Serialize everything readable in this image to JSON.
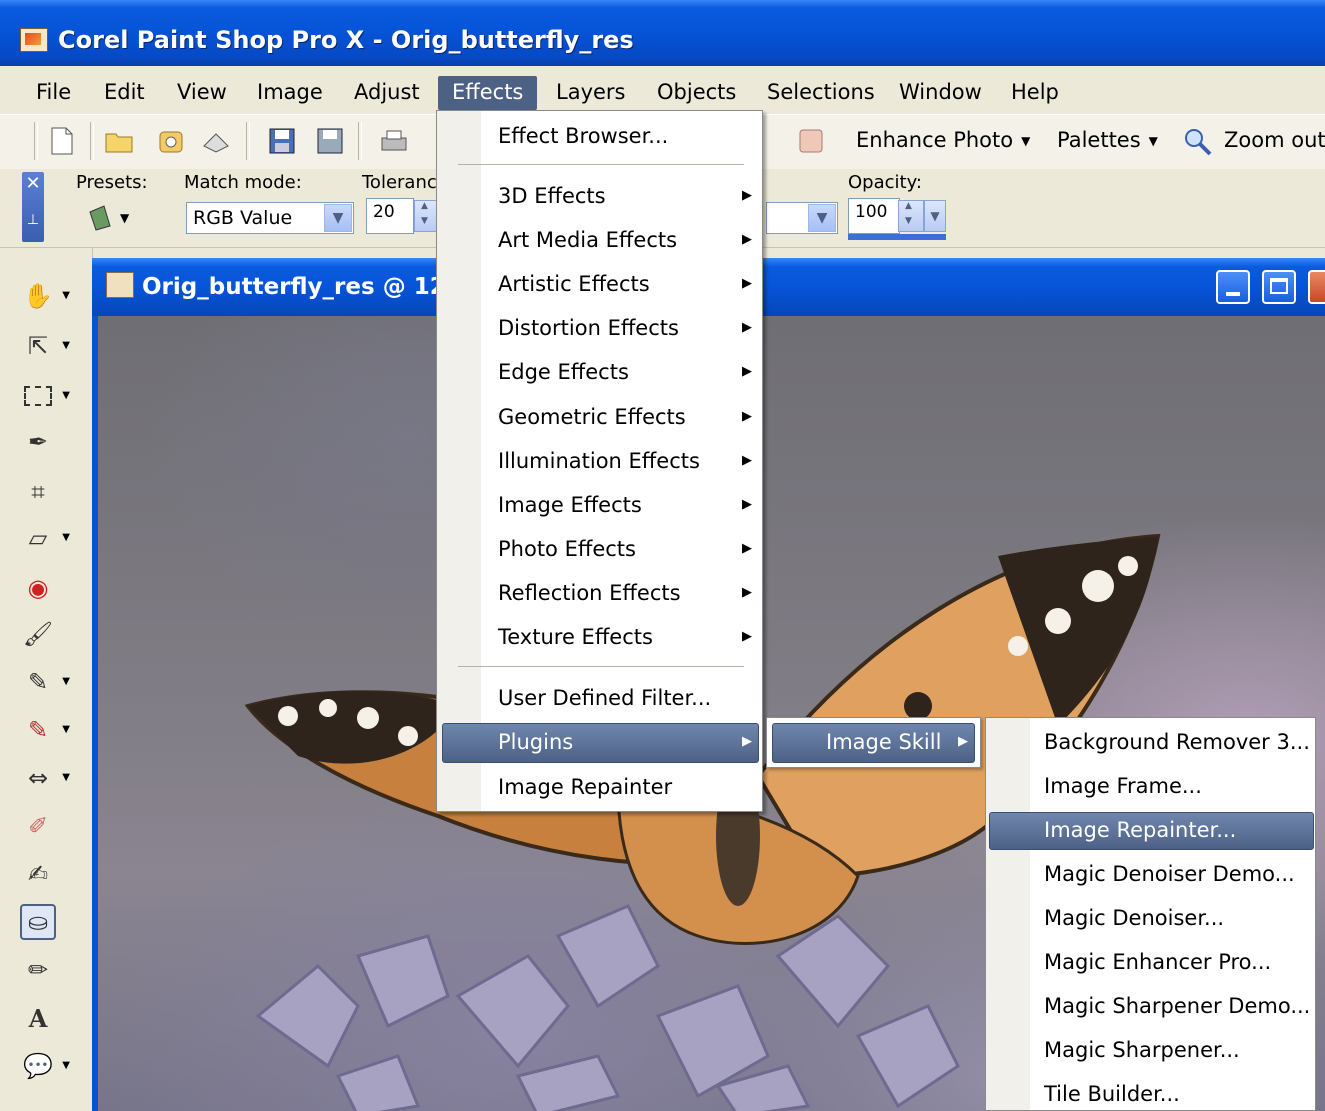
{
  "window": {
    "title": "Corel Paint Shop Pro X - Orig_butterfly_res"
  },
  "menubar": {
    "items": [
      "File",
      "Edit",
      "View",
      "Image",
      "Adjust",
      "Effects",
      "Layers",
      "Objects",
      "Selections",
      "Window",
      "Help"
    ],
    "active": "Effects"
  },
  "toolbar": {
    "enhance_photo": "Enhance Photo",
    "palettes": "Palettes",
    "zoom_out": "Zoom out"
  },
  "options": {
    "presets_label": "Presets:",
    "match_mode_label": "Match mode:",
    "match_mode_value": "RGB Value",
    "tolerance_label": "Toleranc",
    "tolerance_value": "20",
    "opacity_label": "Opacity:",
    "opacity_value": "100"
  },
  "document": {
    "title": "Orig_butterfly_res @ 12"
  },
  "effects_menu": {
    "items": [
      {
        "label": "Effect Browser...",
        "submenu": false
      },
      {
        "label": "3D Effects",
        "submenu": true
      },
      {
        "label": "Art Media Effects",
        "submenu": true
      },
      {
        "label": "Artistic Effects",
        "submenu": true
      },
      {
        "label": "Distortion Effects",
        "submenu": true
      },
      {
        "label": "Edge Effects",
        "submenu": true
      },
      {
        "label": "Geometric Effects",
        "submenu": true
      },
      {
        "label": "Illumination Effects",
        "submenu": true
      },
      {
        "label": "Image Effects",
        "submenu": true
      },
      {
        "label": "Photo Effects",
        "submenu": true
      },
      {
        "label": "Reflection Effects",
        "submenu": true
      },
      {
        "label": "Texture Effects",
        "submenu": true
      },
      {
        "label": "User Defined Filter...",
        "submenu": false
      },
      {
        "label": "Plugins",
        "submenu": true
      },
      {
        "label": "Image Repainter",
        "submenu": false
      }
    ],
    "highlighted": "Plugins"
  },
  "plugins_menu": {
    "items": [
      "Image Skill"
    ],
    "highlighted": "Image Skill"
  },
  "imageskill_menu": {
    "items": [
      "Background Remover 3...",
      "Image Frame...",
      "Image Repainter...",
      "Magic Denoiser Demo...",
      "Magic Denoiser...",
      "Magic Enhancer Pro...",
      "Magic Sharpener Demo...",
      "Magic Sharpener...",
      "Tile Builder..."
    ],
    "highlighted": "Image Repainter..."
  },
  "colors": {
    "xp_blue": "#0653D6",
    "menu_highlight": "#4D6185",
    "face": "#ECE9D8"
  }
}
